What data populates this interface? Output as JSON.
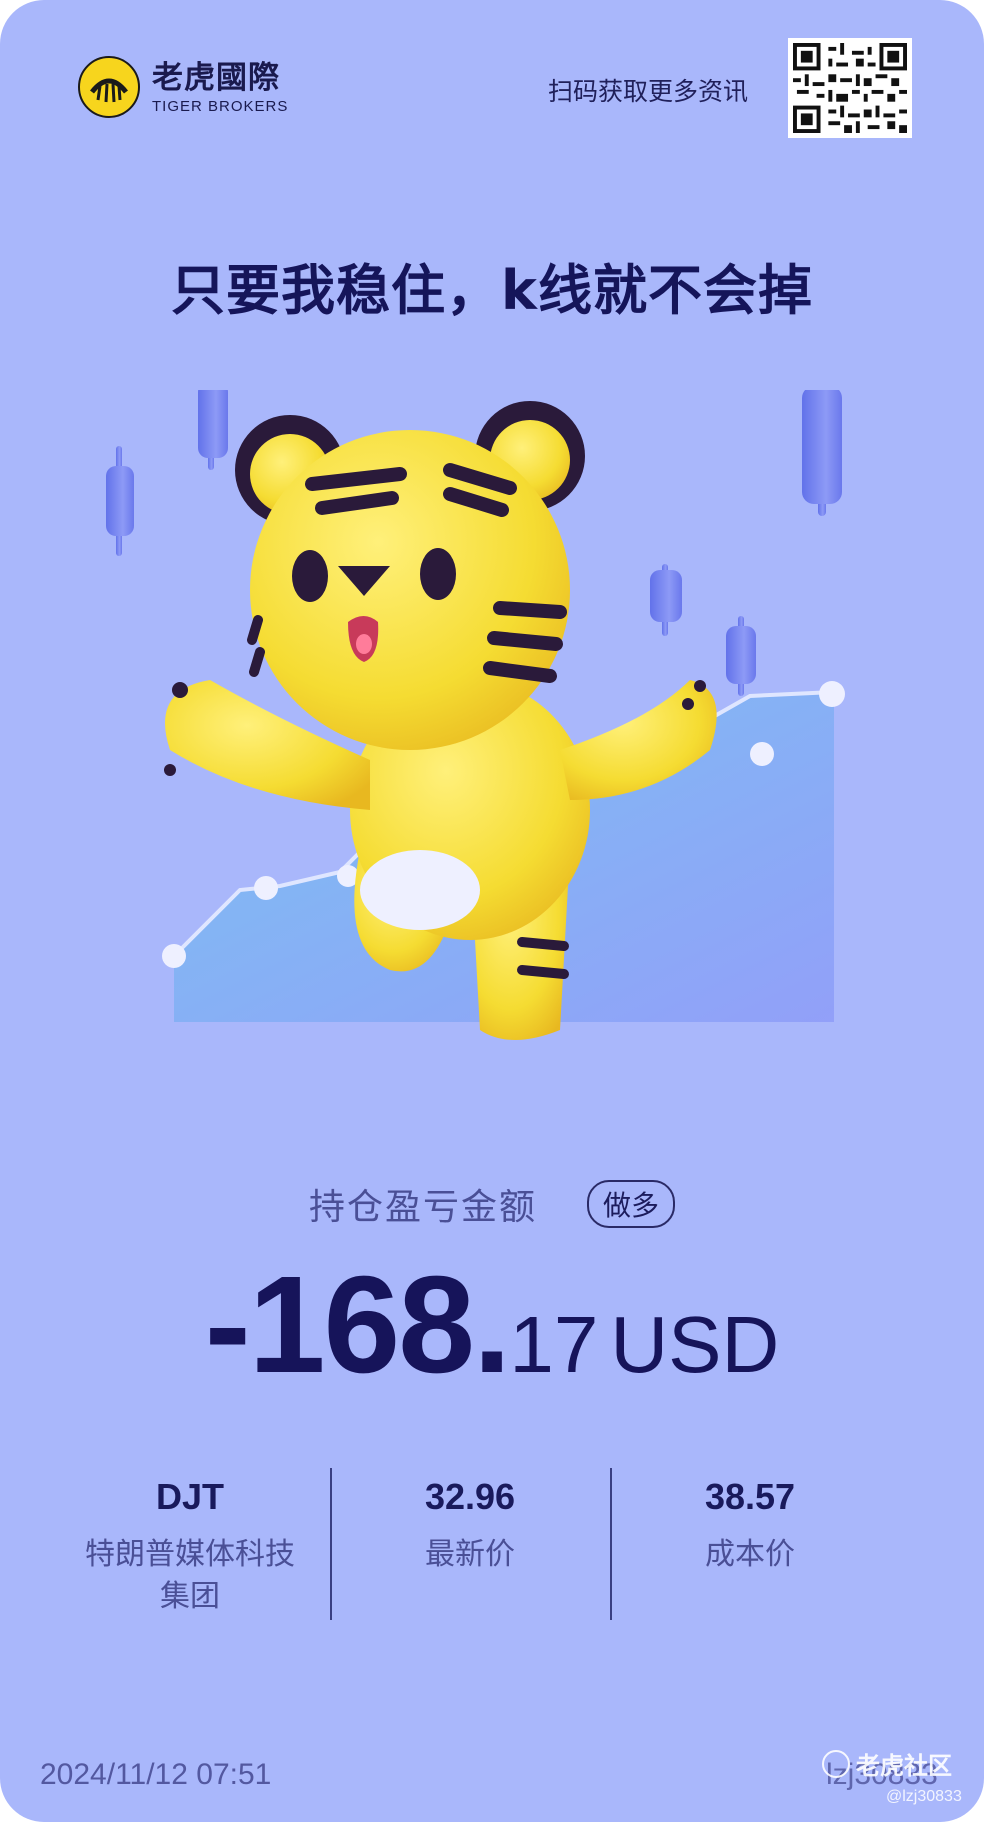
{
  "brand": {
    "name_cn": "老虎國際",
    "name_en": "TIGER BROKERS"
  },
  "header": {
    "scan_text": "扫码获取更多资讯",
    "qr_icon": "qr-code-icon"
  },
  "headline": "只要我稳住，k线就不会掉",
  "illustration": {
    "icon": "tiger-mascot-candlestick-icon"
  },
  "position": {
    "label": "持仓盈亏金额",
    "direction_badge": "做多",
    "amount_int": "-168.",
    "amount_dec": "17",
    "currency": "USD"
  },
  "stats": {
    "ticker": "DJT",
    "company": "特朗普媒体科技集团",
    "latest_price": "32.96",
    "latest_price_label": "最新价",
    "cost_price": "38.57",
    "cost_price_label": "成本价"
  },
  "footer": {
    "datetime": "2024/11/12 07:51",
    "username": "lzj30833",
    "watermark": "老虎社区",
    "watermark_handle": "@lzj30833"
  },
  "colors": {
    "background": "#a9b7fb",
    "primary_text": "#16145a",
    "tiger_yellow": "#f4dc3a",
    "candle_blue": "#7b8af2"
  }
}
